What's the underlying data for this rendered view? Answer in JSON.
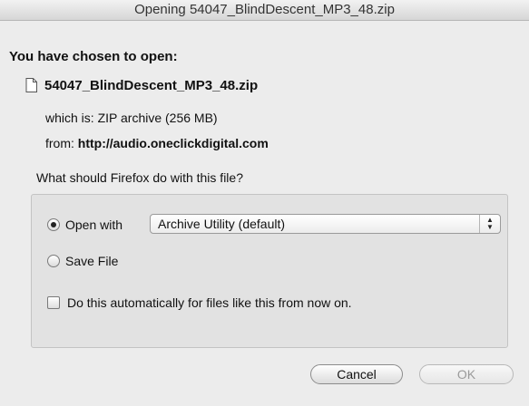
{
  "window": {
    "title": "Opening 54047_BlindDescent_MP3_48.zip"
  },
  "dialog": {
    "heading": "You have chosen to open:",
    "file_icon": "document-icon",
    "file_name": "54047_BlindDescent_MP3_48.zip",
    "type_prefix": "which is:",
    "type_value": "ZIP archive (256 MB)",
    "from_prefix": "from:",
    "from_value": "http://audio.oneclickdigital.com",
    "question": "What should Firefox do with this file?",
    "options": {
      "open_with_label": "Open with",
      "open_with_selected": true,
      "app_selected": "Archive Utility (default)",
      "save_file_label": "Save File",
      "save_file_selected": false
    },
    "auto_checkbox": {
      "label": "Do this automatically for files like this from now on.",
      "checked": false
    },
    "buttons": {
      "cancel": "Cancel",
      "ok": "OK"
    }
  }
}
